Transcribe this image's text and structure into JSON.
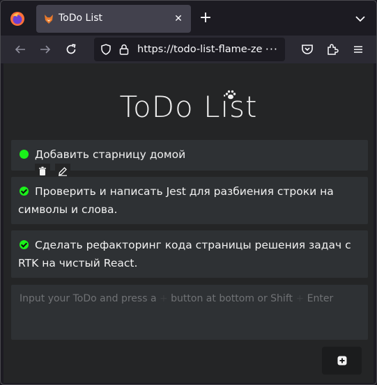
{
  "browser": {
    "tab": {
      "title": "ToDo List",
      "close_glyph": "✕"
    },
    "new_tab_glyph": "+",
    "url": "https://todo-list-flame-zet",
    "url_menu_glyph": "···"
  },
  "page": {
    "title": "ToDo List",
    "todos": [
      {
        "text": "Добавить старницу домой",
        "status": "active"
      },
      {
        "text": "Проверить и написать Jest для разбиения строки на символы и слова.",
        "status": "done"
      },
      {
        "text": "Сделать рефакторинг кода страницы решения задач с RTK на чистый React.",
        "status": "done"
      }
    ],
    "input": {
      "placeholder_prefix": "Input your ToDo and press a",
      "placeholder_mid": "button at bottom or Shift",
      "placeholder_suffix": "Enter",
      "plus_glyph": "+"
    }
  },
  "colors": {
    "accent_green": "#1af21a",
    "page_bg": "#242526",
    "card_bg": "#2e3134"
  }
}
